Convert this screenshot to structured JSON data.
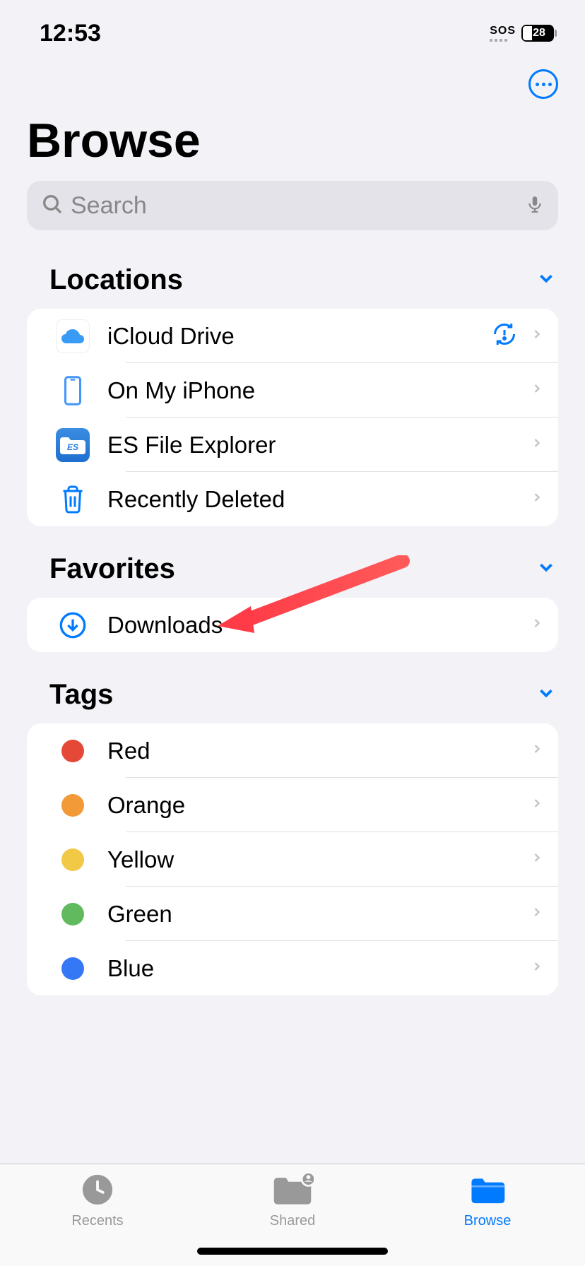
{
  "status": {
    "time": "12:53",
    "sos": "SOS",
    "battery": "28"
  },
  "title": "Browse",
  "search": {
    "placeholder": "Search"
  },
  "sections": {
    "locations": {
      "title": "Locations",
      "items": [
        {
          "label": "iCloud Drive"
        },
        {
          "label": "On My iPhone"
        },
        {
          "label": "ES File Explorer"
        },
        {
          "label": "Recently Deleted"
        }
      ]
    },
    "favorites": {
      "title": "Favorites",
      "items": [
        {
          "label": "Downloads"
        }
      ]
    },
    "tags": {
      "title": "Tags",
      "items": [
        {
          "label": "Red"
        },
        {
          "label": "Orange"
        },
        {
          "label": "Yellow"
        },
        {
          "label": "Green"
        },
        {
          "label": "Blue"
        }
      ]
    }
  },
  "tabbar": {
    "recents": "Recents",
    "shared": "Shared",
    "browse": "Browse"
  }
}
